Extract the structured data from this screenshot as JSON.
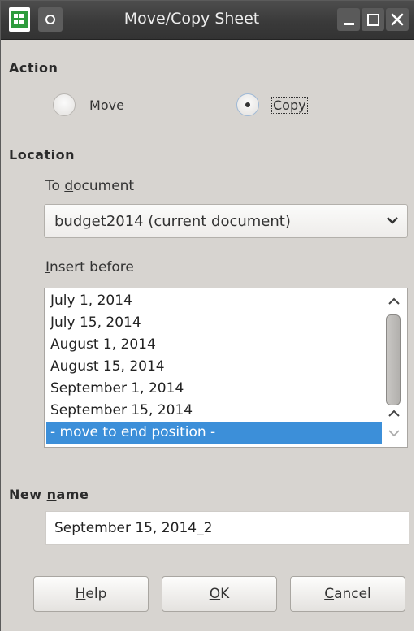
{
  "window": {
    "title": "Move/Copy Sheet"
  },
  "action": {
    "heading": "Action",
    "options": [
      {
        "label_mn": "M",
        "label_rest": "ove",
        "selected": false
      },
      {
        "label_mn": "C",
        "label_rest": "opy",
        "selected": true
      }
    ]
  },
  "location": {
    "heading": "Location",
    "to_document_pre": "To ",
    "to_document_mn": "d",
    "to_document_rest": "ocument",
    "document_value": "budget2014 (current document)",
    "insert_before_mn": "I",
    "insert_before_rest": "nsert before",
    "items": [
      "July 1, 2014",
      "July 15, 2014",
      "August 1, 2014",
      "August 15, 2014",
      "September 1, 2014",
      "September 15, 2014",
      "- move to end position -"
    ],
    "selected_index": 6
  },
  "new_name": {
    "label_pre": "New ",
    "label_mn": "n",
    "label_rest": "ame",
    "value": "September 15, 2014_2"
  },
  "buttons": {
    "help_mn": "H",
    "help_rest": "elp",
    "ok_mn": "O",
    "ok_rest": "K",
    "cancel_mn": "C",
    "cancel_rest": "ancel"
  },
  "colors": {
    "selection": "#3c8fd9",
    "dialog_bg": "#d7d4d0",
    "titlebar": "#3a3a3a"
  }
}
